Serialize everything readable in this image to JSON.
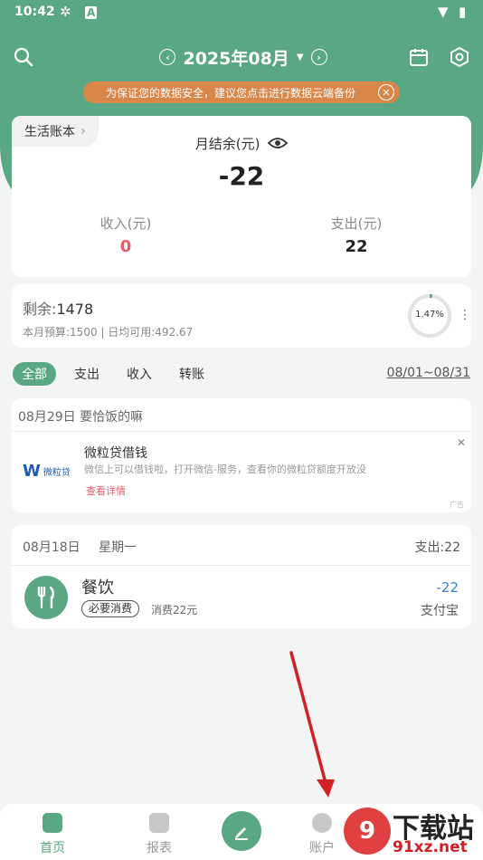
{
  "status_bar": {
    "time": "10:42"
  },
  "header": {
    "month": "2025年08月"
  },
  "banner": {
    "text": "为保证您的数据安全，建议您点击进行数据云端备份"
  },
  "summary": {
    "book_name": "生活账本",
    "balance_label": "月结余(元)",
    "balance_value": "-22",
    "income_label": "收入(元)",
    "income_value": "0",
    "expense_label": "支出(元)",
    "expense_value": "22"
  },
  "budget": {
    "remaining_label": "剩余:",
    "remaining_value": "1478",
    "detail": "本月预算:1500 | 日均可用:492.67",
    "percent": "1.47%",
    "percent_value": 1.47
  },
  "filters": {
    "tabs": [
      "全部",
      "支出",
      "收入",
      "转账"
    ],
    "active": 0,
    "date_range": "08/01~08/31"
  },
  "ad": {
    "date_line": "08月29日  要恰饭的嘛",
    "logo_text": "微粒贷",
    "title": "微粒贷借钱",
    "desc": "微信上可以借钱啦，打开微信-服务，查看你的微粒贷额度开放没",
    "link": "查看详情",
    "tag": "广告"
  },
  "day_group": {
    "date": "08月18日",
    "weekday": "星期一",
    "total": "支出:22",
    "entry": {
      "category": "餐饮",
      "tag": "必要消费",
      "note": "消费22元",
      "amount": "-22",
      "account": "支付宝"
    }
  },
  "bottom_nav": {
    "home": "首页",
    "report": "报表",
    "account": "账户"
  },
  "watermark": {
    "text1": "下载站",
    "text2": "91xz.net"
  },
  "colors": {
    "primary": "#5aa883",
    "income": "#e35d6a",
    "amount_blue": "#3a7fd5",
    "banner": "#d8874a"
  }
}
